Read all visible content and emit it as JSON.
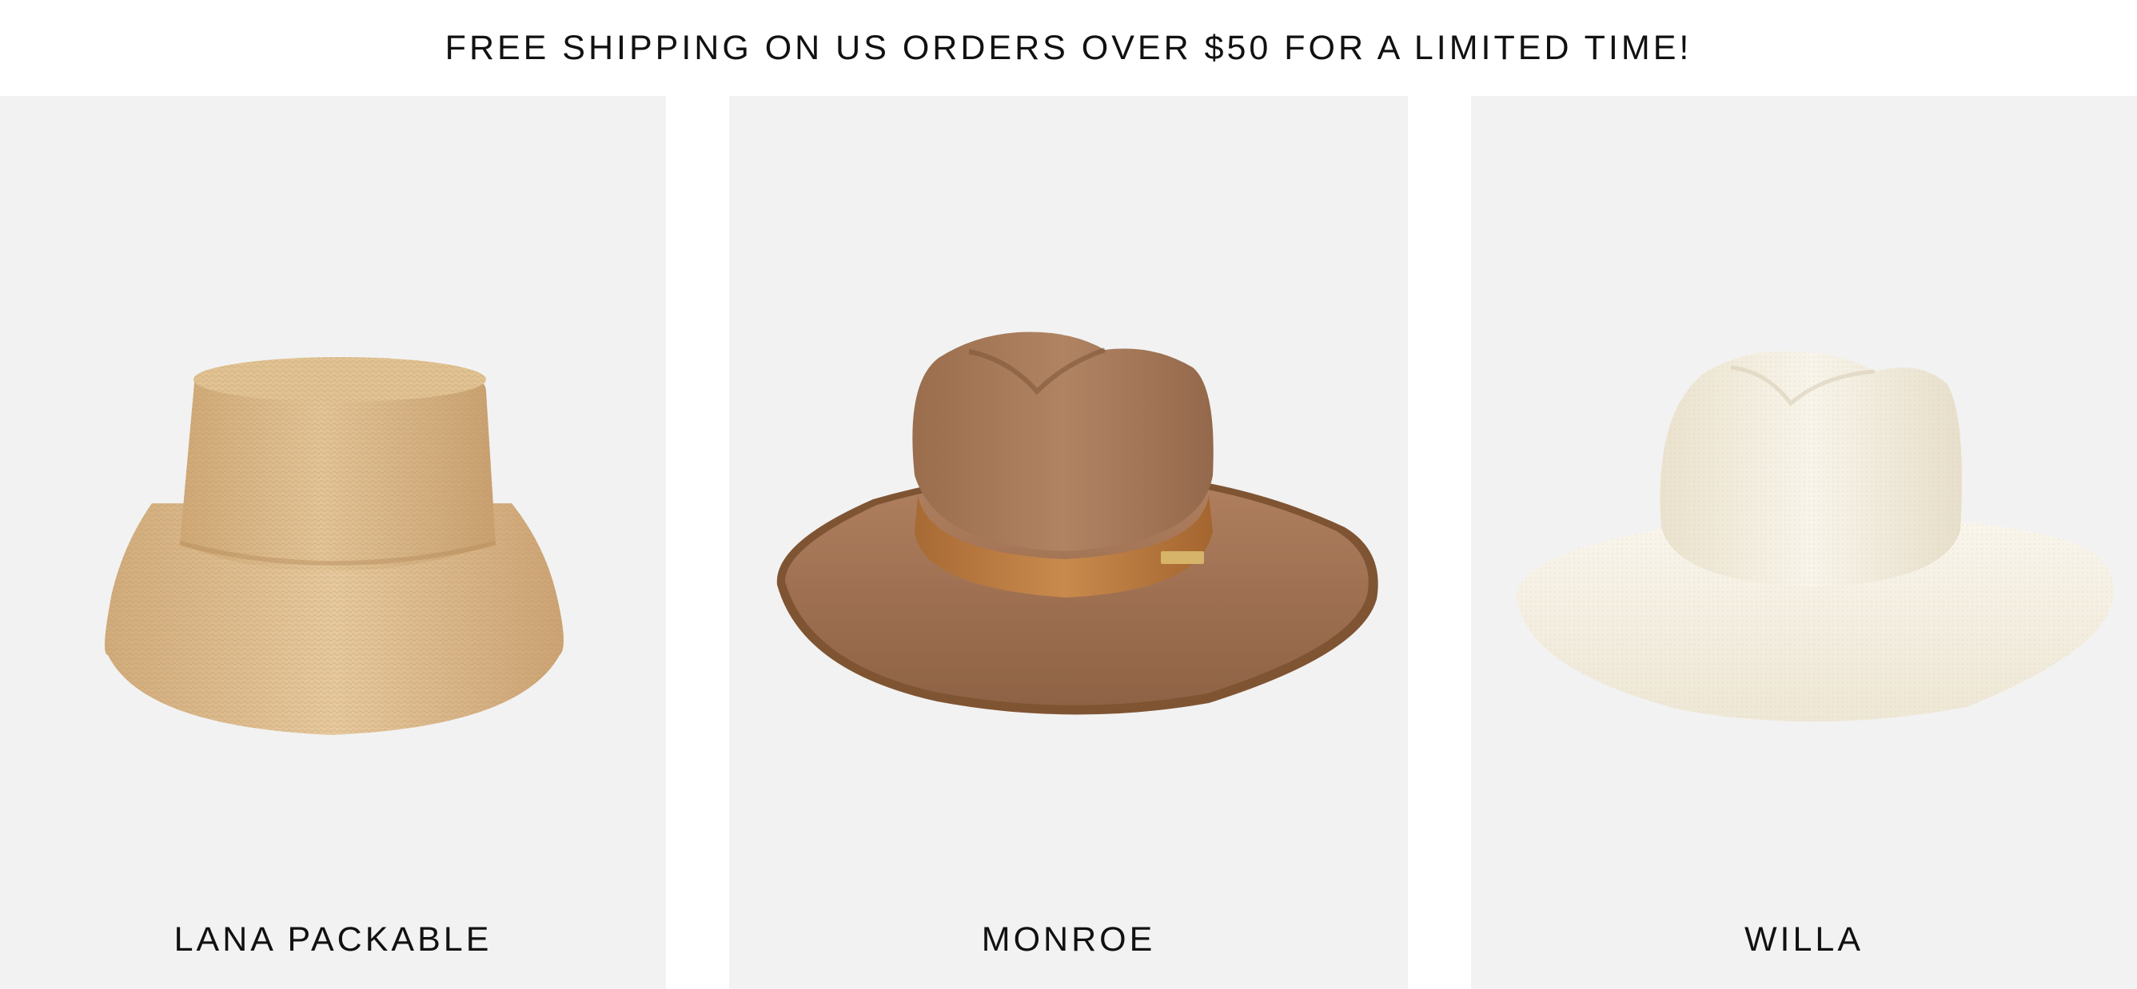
{
  "banner": {
    "text": "FREE SHIPPING ON US ORDERS OVER $50 FOR A LIMITED TIME!"
  },
  "products": [
    {
      "name": "LANA PACKABLE",
      "image": "bucket-hat-icon",
      "color": "#d9b889"
    },
    {
      "name": "MONROE",
      "image": "fedora-hat-icon",
      "color": "#a87a57"
    },
    {
      "name": "WILLA",
      "image": "panama-hat-icon",
      "color": "#f4efe3"
    }
  ],
  "colors": {
    "card_background": "#f2f2f2",
    "text": "#111111"
  }
}
